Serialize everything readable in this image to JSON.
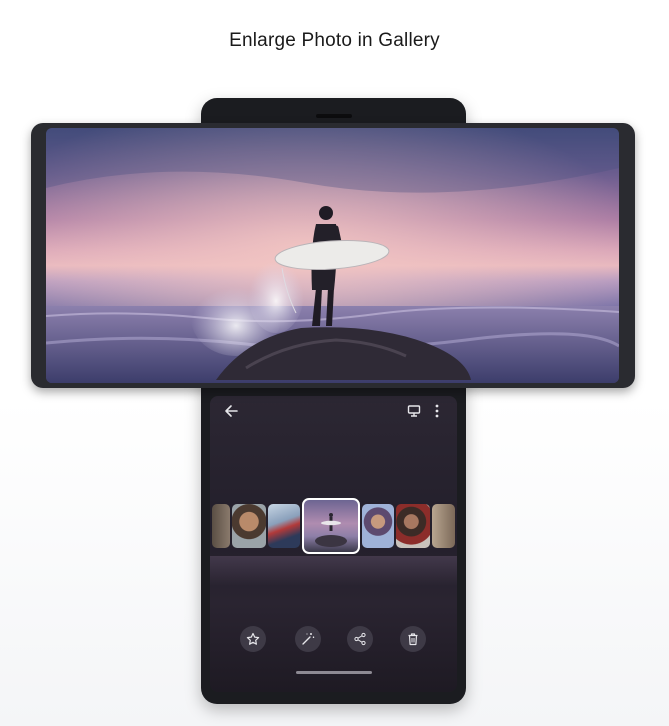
{
  "page": {
    "title": "Enlarge Photo in Gallery"
  },
  "gallery": {
    "top_bar": {
      "back": "back-arrow-icon",
      "cast": "cast-icon",
      "more": "more-vertical-icon"
    },
    "actions": [
      "star-icon",
      "magic-wand-icon",
      "share-icon",
      "trash-icon"
    ]
  },
  "colors": {
    "device": "#1b1c20",
    "sky_top": "#3f4a78",
    "sky_glow": "#e8b8bf",
    "sea": "#5a5a8e"
  }
}
